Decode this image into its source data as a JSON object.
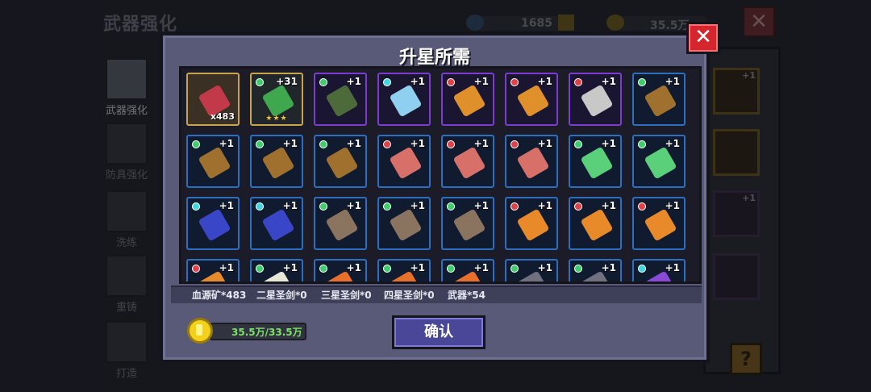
{
  "background": {
    "title": "武器强化",
    "resource_1_value": "1685",
    "resource_2_value": "35.5万",
    "sidebar": [
      {
        "label": "武器强化",
        "active": true
      },
      {
        "label": "防具强化",
        "active": false
      },
      {
        "label": "洗练",
        "active": false
      },
      {
        "label": "重铸",
        "active": false
      },
      {
        "label": "打造",
        "active": false
      }
    ],
    "right_slot_levels": [
      "+1",
      "+1"
    ],
    "help_label": "?",
    "close_label": "✕"
  },
  "modal": {
    "title": "升星所需",
    "close_label": "✕",
    "confirm_label": "确认",
    "cost_text": "35.5万/33.5万",
    "requirements": [
      "血源矿*483",
      "二星圣剑*0",
      "三星圣剑*0",
      "四星圣剑*0",
      "武器*54"
    ]
  },
  "items": [
    {
      "name": "blood-ore-icon",
      "frame": "gold",
      "gem": "",
      "level": "",
      "count": "x483",
      "stars": ""
    },
    {
      "name": "green-blaster-icon",
      "frame": "gold2",
      "gem": "green",
      "level": "+31",
      "count": "",
      "stars": "★★★"
    },
    {
      "name": "green-rifle-icon",
      "frame": "purple",
      "gem": "green",
      "level": "+1",
      "count": "",
      "stars": ""
    },
    {
      "name": "ice-sword-icon",
      "frame": "purple",
      "gem": "cyan",
      "level": "+1",
      "count": "",
      "stars": ""
    },
    {
      "name": "slingshot-icon",
      "frame": "purple",
      "gem": "red",
      "level": "+1",
      "count": "",
      "stars": ""
    },
    {
      "name": "slingshot-icon",
      "frame": "purple",
      "gem": "red",
      "level": "+1",
      "count": "",
      "stars": ""
    },
    {
      "name": "hook-icon",
      "frame": "purple",
      "gem": "red",
      "level": "+1",
      "count": "",
      "stars": ""
    },
    {
      "name": "shotgun-icon",
      "frame": "blue",
      "gem": "green",
      "level": "+1",
      "count": "",
      "stars": ""
    },
    {
      "name": "shotgun-icon",
      "frame": "blue",
      "gem": "green",
      "level": "+1",
      "count": "",
      "stars": ""
    },
    {
      "name": "shotgun-icon",
      "frame": "blue",
      "gem": "green",
      "level": "+1",
      "count": "",
      "stars": ""
    },
    {
      "name": "shotgun-icon",
      "frame": "blue",
      "gem": "green",
      "level": "+1",
      "count": "",
      "stars": ""
    },
    {
      "name": "claw-icon",
      "frame": "blue",
      "gem": "red",
      "level": "+1",
      "count": "",
      "stars": ""
    },
    {
      "name": "claw-icon",
      "frame": "blue",
      "gem": "red",
      "level": "+1",
      "count": "",
      "stars": ""
    },
    {
      "name": "claw-icon",
      "frame": "blue",
      "gem": "red",
      "level": "+1",
      "count": "",
      "stars": ""
    },
    {
      "name": "green-dagger-icon",
      "frame": "blue",
      "gem": "green",
      "level": "+1",
      "count": "",
      "stars": ""
    },
    {
      "name": "green-dagger-icon",
      "frame": "blue",
      "gem": "green",
      "level": "+1",
      "count": "",
      "stars": ""
    },
    {
      "name": "smg-icon",
      "frame": "blue",
      "gem": "cyan",
      "level": "+1",
      "count": "",
      "stars": ""
    },
    {
      "name": "smg-icon",
      "frame": "blue",
      "gem": "cyan",
      "level": "+1",
      "count": "",
      "stars": ""
    },
    {
      "name": "stone-block-icon",
      "frame": "blue",
      "gem": "green",
      "level": "+1",
      "count": "",
      "stars": ""
    },
    {
      "name": "stone-block-icon",
      "frame": "blue",
      "gem": "green",
      "level": "+1",
      "count": "",
      "stars": ""
    },
    {
      "name": "stone-block-icon",
      "frame": "blue",
      "gem": "green",
      "level": "+1",
      "count": "",
      "stars": ""
    },
    {
      "name": "lantern-icon",
      "frame": "blue",
      "gem": "red",
      "level": "+1",
      "count": "",
      "stars": ""
    },
    {
      "name": "lantern-icon",
      "frame": "blue",
      "gem": "red",
      "level": "+1",
      "count": "",
      "stars": ""
    },
    {
      "name": "lantern-icon",
      "frame": "blue",
      "gem": "red",
      "level": "+1",
      "count": "",
      "stars": ""
    },
    {
      "name": "lantern-icon",
      "frame": "blue",
      "gem": "red",
      "level": "+1",
      "count": "",
      "stars": ""
    },
    {
      "name": "skull-icon",
      "frame": "blue",
      "gem": "green",
      "level": "+1",
      "count": "",
      "stars": ""
    },
    {
      "name": "carrot-icon",
      "frame": "blue",
      "gem": "green",
      "level": "+1",
      "count": "",
      "stars": ""
    },
    {
      "name": "carrot-icon",
      "frame": "blue",
      "gem": "green",
      "level": "+1",
      "count": "",
      "stars": ""
    },
    {
      "name": "carrot-icon",
      "frame": "blue",
      "gem": "green",
      "level": "+1",
      "count": "",
      "stars": ""
    },
    {
      "name": "flail-icon",
      "frame": "blue",
      "gem": "green",
      "level": "+1",
      "count": "",
      "stars": ""
    },
    {
      "name": "flail-icon",
      "frame": "blue",
      "gem": "green",
      "level": "+1",
      "count": "",
      "stars": ""
    },
    {
      "name": "purple-blade-icon",
      "frame": "blue",
      "gem": "cyan",
      "level": "+1",
      "count": "",
      "stars": ""
    }
  ]
}
